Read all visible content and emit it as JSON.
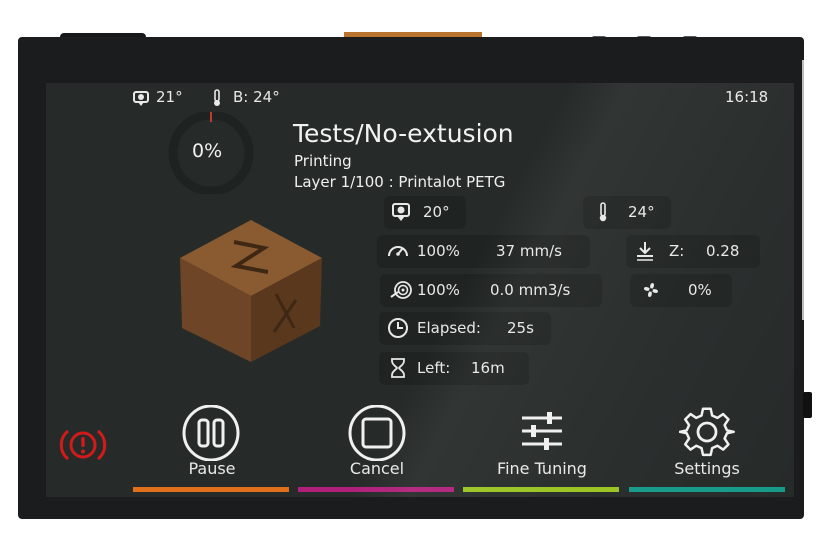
{
  "status_bar": {
    "extruder_temp": "21°",
    "bed_temp": "B: 24°",
    "clock": "16:18"
  },
  "progress": {
    "percent_label": "0%",
    "fraction": 0
  },
  "job": {
    "title": "Tests/No-extusion",
    "state": "Printing",
    "layer_info": "Layer 1/100 : Printalot PETG"
  },
  "stats": {
    "extruder_temp": "20°",
    "bed_temp": "24°",
    "speed_factor": "100%",
    "speed": "37 mm/s",
    "z_label": "Z:",
    "z_value": "0.28",
    "flow_factor": "100%",
    "flow_rate": "0.0 mm3/s",
    "fan": "0%",
    "elapsed_label": "Elapsed:",
    "elapsed_value": "25s",
    "left_label": "Left:",
    "left_value": "16m"
  },
  "actions": [
    {
      "label": "Pause",
      "color": "#e0701a"
    },
    {
      "label": "Cancel",
      "color": "#b0207a"
    },
    {
      "label": "Fine Tuning",
      "color": "#98c420"
    },
    {
      "label": "Settings",
      "color": "#169a8a"
    }
  ],
  "icons": {
    "extruder": "extruder-icon",
    "thermometer": "thermometer-icon",
    "speedometer": "speedometer-icon",
    "z_offset": "z-offset-icon",
    "flow": "flow-icon",
    "fan": "fan-icon",
    "clock": "clock-icon",
    "hourglass": "hourglass-icon",
    "emergency_stop": "emergency-stop-icon"
  },
  "colors": {
    "screen_bg": "#262b2a",
    "panel_bg": "#1f2322",
    "emergency": "#d11a1a",
    "progress_accent": "#c0392b"
  }
}
